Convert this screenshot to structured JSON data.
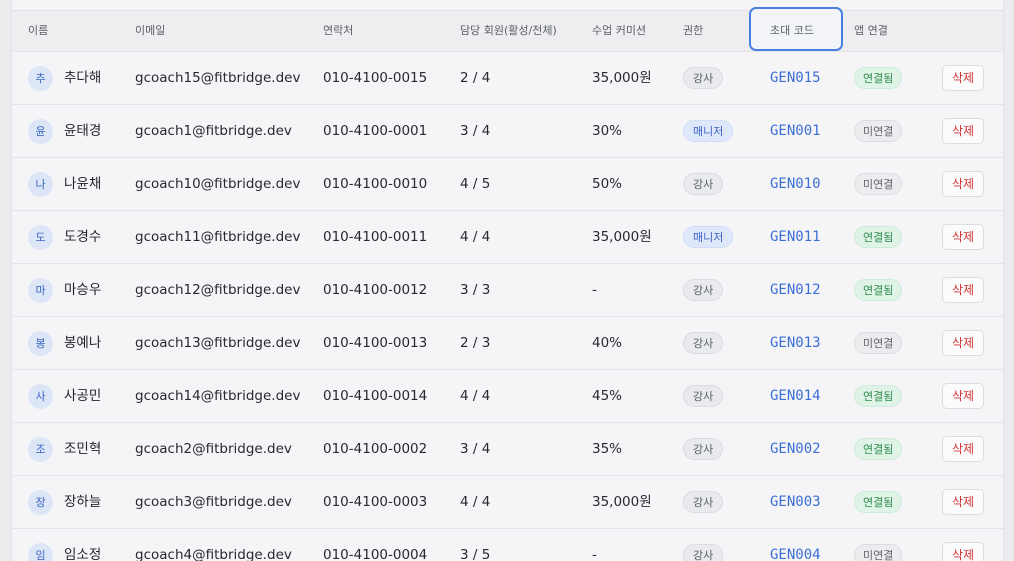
{
  "headers": {
    "name": "이름",
    "email": "이메일",
    "phone": "연락처",
    "members": "담당 회원(활성/전체)",
    "commission": "수업 커미션",
    "role": "권한",
    "invite_code": "초대 코드",
    "app_link": "앱 연결"
  },
  "delete_label": "삭제",
  "rows": [
    {
      "initial": "추",
      "name": "추다해",
      "email": "gcoach15@fitbridge.dev",
      "phone": "010-4100-0015",
      "members": "2 / 4",
      "commission": "35,000원",
      "role": "강사",
      "role_type": "coach",
      "code": "GEN015",
      "app": "연결됨",
      "app_state": "on"
    },
    {
      "initial": "윤",
      "name": "윤태경",
      "email": "gcoach1@fitbridge.dev",
      "phone": "010-4100-0001",
      "members": "3 / 4",
      "commission": "30%",
      "role": "매니저",
      "role_type": "manager",
      "code": "GEN001",
      "app": "미연결",
      "app_state": "off"
    },
    {
      "initial": "나",
      "name": "나윤채",
      "email": "gcoach10@fitbridge.dev",
      "phone": "010-4100-0010",
      "members": "4 / 5",
      "commission": "50%",
      "role": "강사",
      "role_type": "coach",
      "code": "GEN010",
      "app": "미연결",
      "app_state": "off"
    },
    {
      "initial": "도",
      "name": "도경수",
      "email": "gcoach11@fitbridge.dev",
      "phone": "010-4100-0011",
      "members": "4 / 4",
      "commission": "35,000원",
      "role": "매니저",
      "role_type": "manager",
      "code": "GEN011",
      "app": "연결됨",
      "app_state": "on"
    },
    {
      "initial": "마",
      "name": "마승우",
      "email": "gcoach12@fitbridge.dev",
      "phone": "010-4100-0012",
      "members": "3 / 3",
      "commission": "-",
      "role": "강사",
      "role_type": "coach",
      "code": "GEN012",
      "app": "연결됨",
      "app_state": "on"
    },
    {
      "initial": "봉",
      "name": "봉예나",
      "email": "gcoach13@fitbridge.dev",
      "phone": "010-4100-0013",
      "members": "2 / 3",
      "commission": "40%",
      "role": "강사",
      "role_type": "coach",
      "code": "GEN013",
      "app": "미연결",
      "app_state": "off"
    },
    {
      "initial": "사",
      "name": "사공민",
      "email": "gcoach14@fitbridge.dev",
      "phone": "010-4100-0014",
      "members": "4 / 4",
      "commission": "45%",
      "role": "강사",
      "role_type": "coach",
      "code": "GEN014",
      "app": "연결됨",
      "app_state": "on"
    },
    {
      "initial": "조",
      "name": "조민혁",
      "email": "gcoach2@fitbridge.dev",
      "phone": "010-4100-0002",
      "members": "3 / 4",
      "commission": "35%",
      "role": "강사",
      "role_type": "coach",
      "code": "GEN002",
      "app": "연결됨",
      "app_state": "on"
    },
    {
      "initial": "장",
      "name": "장하늘",
      "email": "gcoach3@fitbridge.dev",
      "phone": "010-4100-0003",
      "members": "4 / 4",
      "commission": "35,000원",
      "role": "강사",
      "role_type": "coach",
      "code": "GEN003",
      "app": "연결됨",
      "app_state": "on"
    },
    {
      "initial": "임",
      "name": "임소정",
      "email": "gcoach4@fitbridge.dev",
      "phone": "010-4100-0004",
      "members": "3 / 5",
      "commission": "-",
      "role": "강사",
      "role_type": "coach",
      "code": "GEN004",
      "app": "미연결",
      "app_state": "off"
    }
  ]
}
